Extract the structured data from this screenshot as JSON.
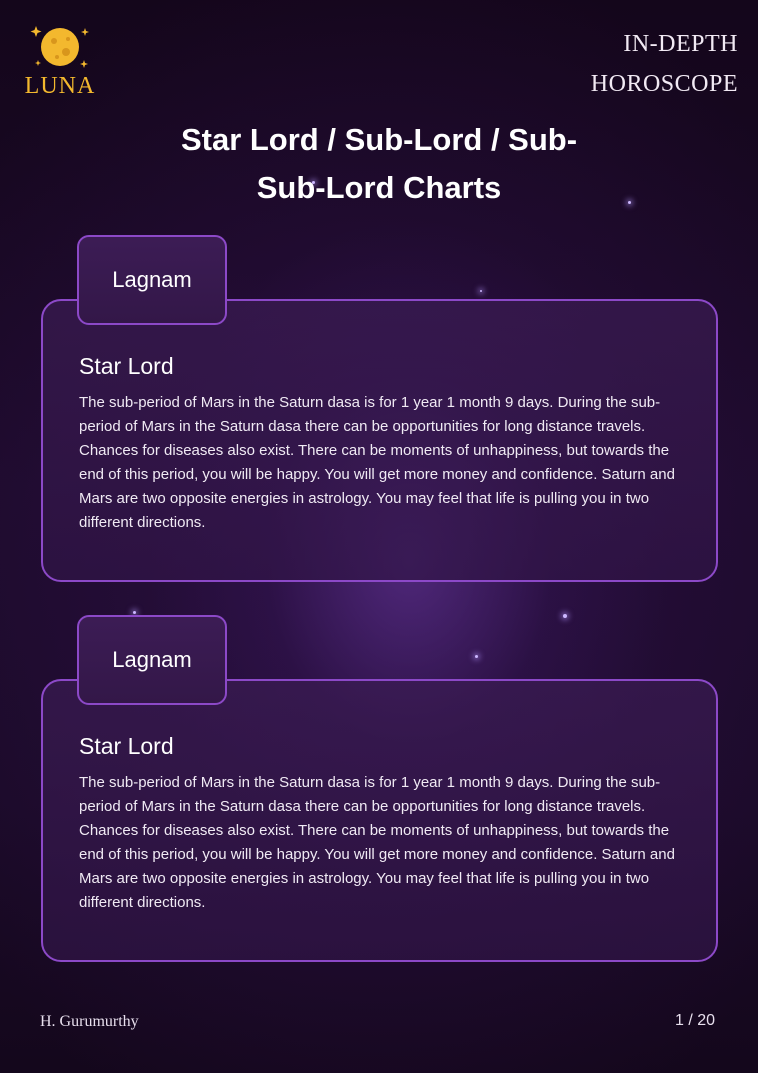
{
  "brand": {
    "name": "LUNA",
    "icon": "moon-stars-icon",
    "accent": "#f3b82e"
  },
  "header": {
    "line1": "IN-DEPTH",
    "line2": "HOROSCOPE"
  },
  "page_title": "Star Lord / Sub-Lord / Sub-Sub-Lord Charts",
  "sections": [
    {
      "tab_label": "Lagnam",
      "heading": "Star Lord",
      "body": "The sub-period of Mars in the Saturn dasa is for 1 year 1 month 9 days. During the sub-period of Mars in the Saturn dasa there can be opportunities for long distance travels. Chances for diseases also exist. There can be moments of unhappiness, but towards the end of this period, you will be happy. You will get more money and confidence. Saturn and Mars are two opposite energies in astrology. You may feel that life is pulling you in two different directions."
    },
    {
      "tab_label": "Lagnam",
      "heading": "Star Lord",
      "body": "The sub-period of Mars in the Saturn dasa is for 1 year 1 month 9 days. During the sub-period of Mars in the Saturn dasa there can be opportunities for long distance travels. Chances for diseases also exist. There can be moments of unhappiness, but towards the end of this period, you will be happy. You will get more money and confidence. Saturn and Mars are two opposite energies in astrology. You may feel that life is pulling you in two different directions."
    }
  ],
  "footer": {
    "author": "H. Gurumurthy",
    "page_indicator": "1 / 20"
  },
  "colors": {
    "border": "#8c49c8",
    "background": "#16081f"
  }
}
